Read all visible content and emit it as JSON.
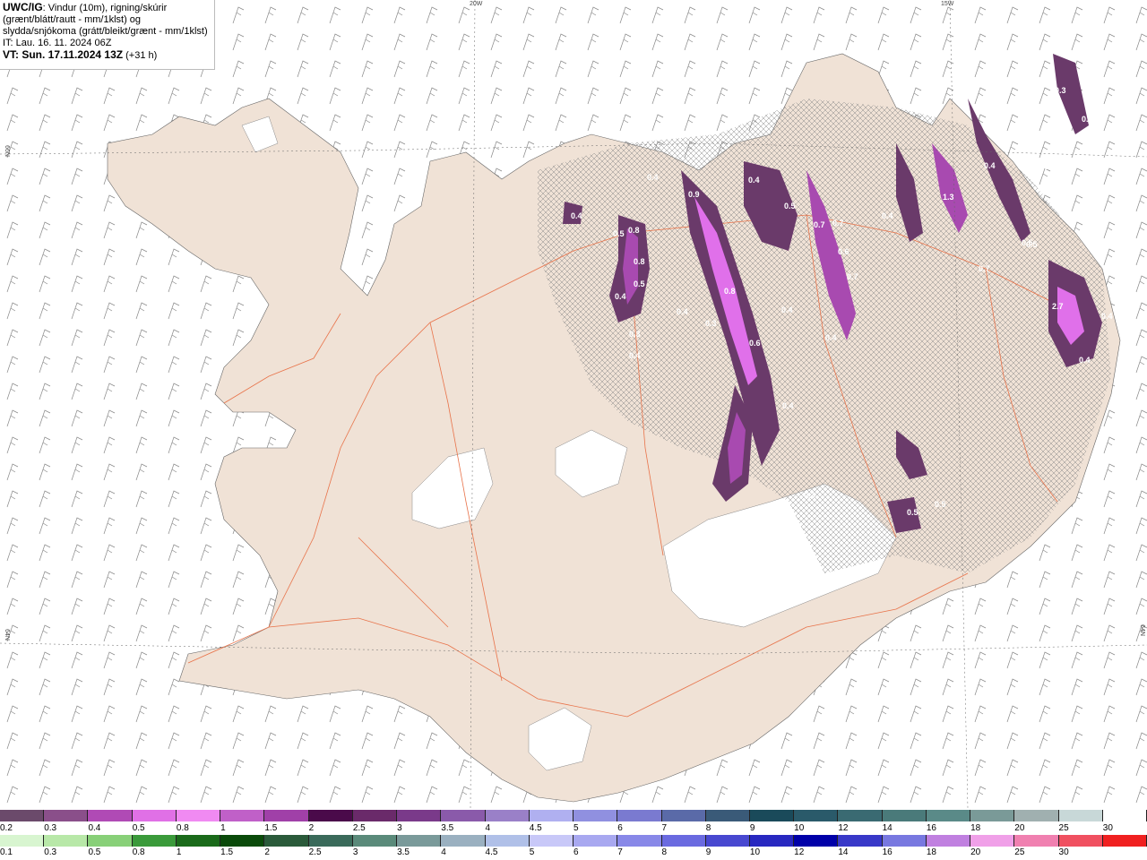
{
  "title": {
    "model": "UWC/IG",
    "description": ": Vindur (10m), rigning/skúrir (grænt/blátt/rautt - mm/1klst) og slydda/snjókoma (grátt/bleikt/grænt - mm/1klst)",
    "issue_time": "IT: Lau. 16. 11. 2024 06Z",
    "valid_time": "VT: Sun. 17.11.2024 13Z",
    "lead": "(+31 h)"
  },
  "grid_labels": {
    "top_20w": "20W",
    "top_15w": "15W",
    "left_66n": "66N",
    "left_64n": "64N",
    "right_64n": "64N"
  },
  "snow_values": [
    {
      "v": "0.4"
    },
    {
      "v": "0.4"
    },
    {
      "v": "0.9"
    },
    {
      "v": "0.5"
    },
    {
      "v": "0.8"
    },
    {
      "v": "0.8"
    },
    {
      "v": "0.5"
    },
    {
      "v": "0.4"
    },
    {
      "v": "0.3"
    },
    {
      "v": "0.4"
    },
    {
      "v": "0.4"
    },
    {
      "v": "0.3"
    },
    {
      "v": "0.8"
    },
    {
      "v": "0.6"
    },
    {
      "v": "0.4"
    },
    {
      "v": "0.5"
    },
    {
      "v": "0.7"
    },
    {
      "v": "0.7"
    },
    {
      "v": "0.6"
    },
    {
      "v": "0.7"
    },
    {
      "v": "0.4"
    },
    {
      "v": "0.4"
    },
    {
      "v": "1.3"
    },
    {
      "v": "0.5"
    },
    {
      "v": "2.7"
    },
    {
      "v": "0.4"
    },
    {
      "v": "0.4"
    },
    {
      "v": "0.7"
    },
    {
      "v": "0.5"
    },
    {
      "v": "0.5"
    },
    {
      "v": "0.3"
    },
    {
      "v": "0.4"
    },
    {
      "v": "0.3"
    },
    {
      "v": "0.5"
    },
    {
      "v": "0.4"
    },
    {
      "v": "0.5"
    },
    {
      "v": "0.6"
    },
    {
      "v": "0.5"
    },
    {
      "v": "0.4"
    }
  ],
  "scale_snow": {
    "colors": [
      "#6b4a6b",
      "#8a4f8a",
      "#b04ab5",
      "#e070e6",
      "#f08af2",
      "#c060c8",
      "#a040a8",
      "#4a0a4a",
      "#6a2a6a",
      "#7a3a8a",
      "#8a5aaa",
      "#9a80c8",
      "#b0b0f0",
      "#9090e0",
      "#7a7ad0",
      "#5a6aa8",
      "#3a5a78",
      "#1a4a5a",
      "#2a5a6a",
      "#3a6a72",
      "#4a7a7a",
      "#5a8a88",
      "#7a9a98",
      "#a0b0b0",
      "#c8d8d8",
      "#ffffff"
    ],
    "labels": [
      "0.2",
      "0.3",
      "0.4",
      "0.5",
      "0.8",
      "1",
      "1.5",
      "2",
      "2.5",
      "3",
      "3.5",
      "4",
      "4.5",
      "5",
      "6",
      "7",
      "8",
      "9",
      "10",
      "12",
      "14",
      "16",
      "18",
      "20",
      "25",
      "30"
    ]
  },
  "scale_rain": {
    "colors": [
      "#d8f5d0",
      "#b8e8a8",
      "#88d078",
      "#3a9a3a",
      "#1a6a1a",
      "#0a4a0a",
      "#2a5a3a",
      "#3a6a5a",
      "#5a8a7a",
      "#7a9a9a",
      "#9ab0c0",
      "#b0c0e8",
      "#c8c8f8",
      "#a8a8f0",
      "#8888e8",
      "#6a6ae0",
      "#4848d0",
      "#2828c0",
      "#0000a8",
      "#3838c8",
      "#7878e0",
      "#c080e0",
      "#f0a0e8",
      "#f080b0",
      "#f05060",
      "#f02020"
    ],
    "labels": [
      "0.1",
      "0.3",
      "0.5",
      "0.8",
      "1",
      "1.5",
      "2",
      "2.5",
      "3",
      "3.5",
      "4",
      "4.5",
      "5",
      "6",
      "7",
      "8",
      "9",
      "10",
      "12",
      "14",
      "16",
      "18",
      "20",
      "25",
      "30"
    ]
  },
  "colors": {
    "land": "#f0e2d6",
    "roads": "#e8734a",
    "snow_band_dark": "#6a3a6a",
    "snow_band_mid": "#a84ab0",
    "snow_band_light": "#e070ea",
    "glacier": "#ffffff"
  }
}
